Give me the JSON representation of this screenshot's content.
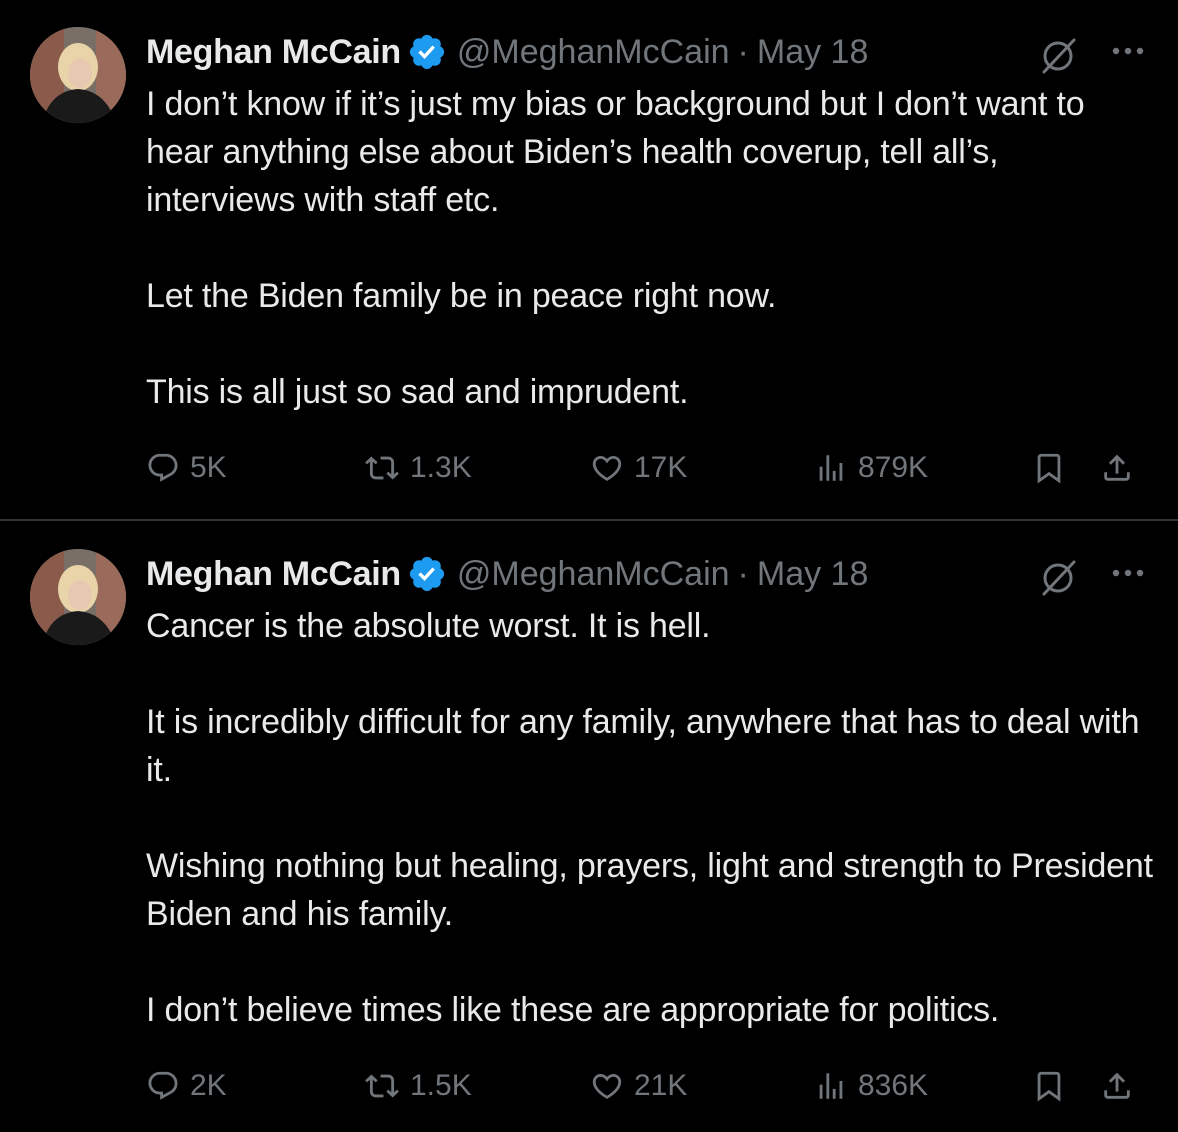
{
  "colors": {
    "background": "#000000",
    "text": "#e7e9ea",
    "muted": "#71767b",
    "verified": "#1d9bf0",
    "divider": "#2f3336"
  },
  "tweets": [
    {
      "author": {
        "name": "Meghan McCain",
        "handle": "@MeghanMcCain",
        "verified_icon": "verified-badge-icon"
      },
      "separator": "·",
      "date": "May 18",
      "paragraphs": [
        "I don’t know if it’s just my bias or background but I don’t want to hear anything else about Biden’s health coverup, tell all’s, interviews with staff etc.",
        "Let the Biden family be in peace right now.",
        "This is all just so sad and imprudent."
      ],
      "stats": {
        "replies": "5K",
        "reposts": "1.3K",
        "likes": "17K",
        "views": "879K"
      }
    },
    {
      "author": {
        "name": "Meghan McCain",
        "handle": "@MeghanMcCain",
        "verified_icon": "verified-badge-icon"
      },
      "separator": "·",
      "date": "May 18",
      "paragraphs": [
        "Cancer is the absolute worst. It is hell.",
        "It is incredibly difficult for any family, anywhere that has to deal with it.",
        "Wishing nothing but healing, prayers, light and strength to President Biden and his family.",
        "I don’t believe times like these are appropriate for politics."
      ],
      "stats": {
        "replies": "2K",
        "reposts": "1.5K",
        "likes": "21K",
        "views": "836K"
      }
    }
  ]
}
